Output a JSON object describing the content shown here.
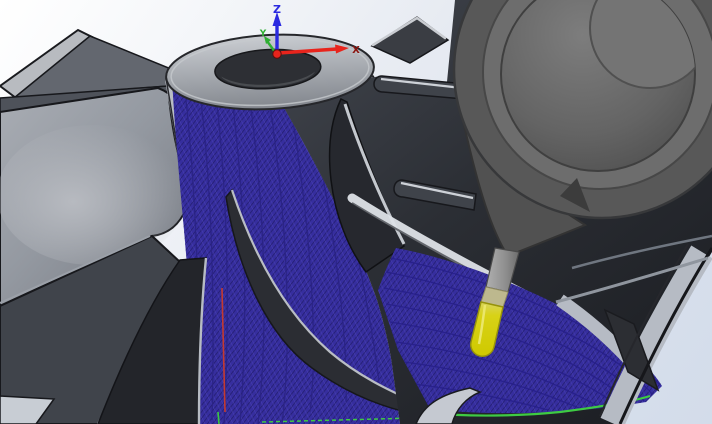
{
  "viewport": {
    "description": "3D CAM machining simulation view of an impeller with toolpath overlay and cutting tool"
  },
  "triad": {
    "z_label": "Z",
    "x_label": "X",
    "y_label": "Y"
  },
  "colors": {
    "toolpath_blue": "#362e9e",
    "toolpath_hatch_dark": "#221c6a",
    "toolpath_hatch_light": "#5a52c4",
    "highlight_green": "#3ecb43",
    "rapid_red": "#c43a30",
    "tool_yellow": "#d6cf00",
    "tool_shank_gray": "#9a9a9a",
    "holder_gray": "#666666",
    "axis_z": "#2a2ae0",
    "axis_x": "#e8241c",
    "axis_x_label": "#8b1510",
    "axis_y": "#2fae32",
    "body_light": "#b9bdc4",
    "body_dark": "#26282d",
    "background_tint": "#d7dfeb"
  }
}
